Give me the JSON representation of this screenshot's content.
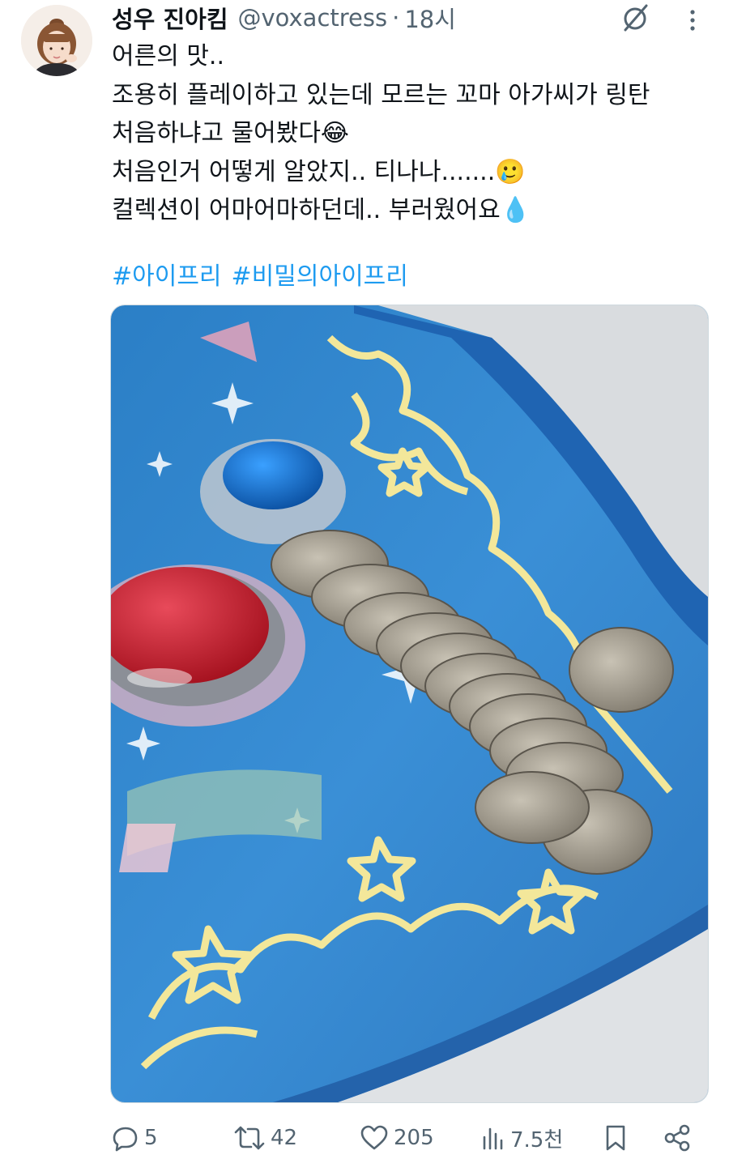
{
  "author": {
    "display_name": "성우 진아킴",
    "handle": "@voxactress",
    "separator": "·",
    "time": "18시"
  },
  "tweet": {
    "lines": [
      "어른의 맛..",
      "조용히 플레이하고 있는데 모르는 꼬마 아가씨가 링탄",
      "처음하냐고 물어봤다😂",
      "처음인거 어떻게 알았지.. 티나나.......🥲",
      "컬렉션이 어마어마하던데.. 부러웠어요💧"
    ],
    "hashtags": [
      "#아이프리",
      "#비밀의아이프리"
    ]
  },
  "actions": {
    "reply_count": "5",
    "retweet_count": "42",
    "like_count": "205",
    "view_count": "7.5천"
  },
  "colors": {
    "link": "#1d9bf0",
    "secondary_text": "#536471",
    "primary_text": "#0f1419"
  },
  "icons": [
    "grok-icon",
    "more-icon",
    "reply-icon",
    "retweet-icon",
    "like-icon",
    "views-icon",
    "bookmark-icon",
    "share-icon"
  ]
}
